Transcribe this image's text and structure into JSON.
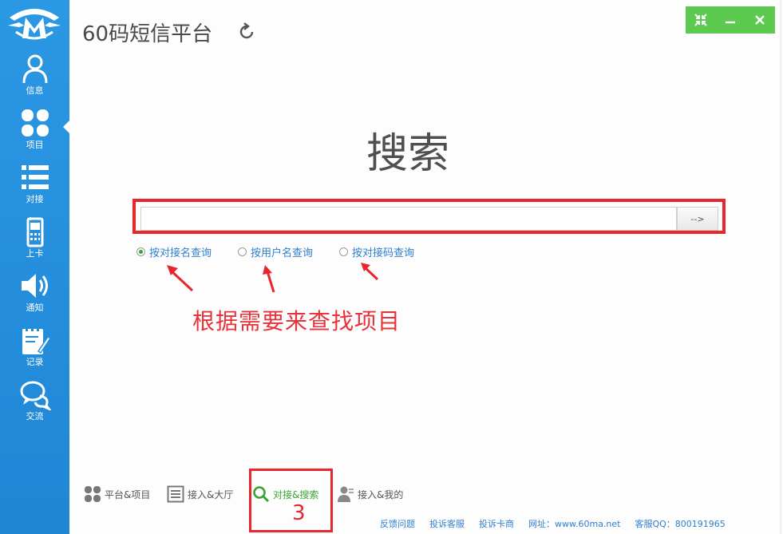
{
  "app": {
    "title": "60码短信平台"
  },
  "sidebar": {
    "items": [
      {
        "label": "信息",
        "icon": "user-icon"
      },
      {
        "label": "项目",
        "icon": "grid-icon"
      },
      {
        "label": "对接",
        "icon": "list-icon"
      },
      {
        "label": "上卡",
        "icon": "phone-icon"
      },
      {
        "label": "通知",
        "icon": "speaker-icon"
      },
      {
        "label": "记录",
        "icon": "notepad-icon"
      },
      {
        "label": "交流",
        "icon": "chat-icon"
      }
    ],
    "active_index": 1
  },
  "search": {
    "heading": "搜索",
    "input_value": "",
    "go_label": "-->",
    "options": [
      {
        "label": "按对接名查询",
        "checked": true
      },
      {
        "label": "按用户名查询",
        "checked": false
      },
      {
        "label": "按对接码查询",
        "checked": false
      }
    ]
  },
  "annotation": {
    "text": "根据需要来查找项目",
    "step_number": "3"
  },
  "bottom_nav": [
    {
      "label": "平台&项目",
      "icon": "grid-icon",
      "active": false
    },
    {
      "label": "接入&大厅",
      "icon": "list-box-icon",
      "active": false
    },
    {
      "label": "对接&搜索",
      "icon": "search-icon",
      "active": true
    },
    {
      "label": "接入&我的",
      "icon": "person-icon",
      "active": false
    }
  ],
  "footer": {
    "items": [
      "反馈问题",
      "投诉客服",
      "投诉卡商",
      "网址：www.60ma.net",
      "客服QQ：800191965"
    ]
  },
  "colors": {
    "sidebar": "#2290de",
    "window_controls": "#5cc94f",
    "annotation": "#e8262c",
    "link": "#2f7fd0"
  }
}
